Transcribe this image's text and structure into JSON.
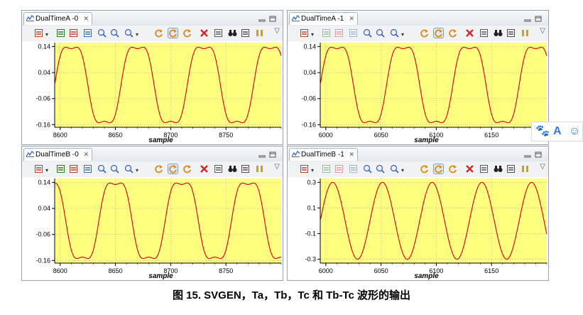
{
  "panels": [
    {
      "tab_title": "DualTimeA -0",
      "xlabel": "sample",
      "xlim": [
        8595,
        8800
      ],
      "ylim": [
        -0.17,
        0.155
      ],
      "yticks": [
        "0.14",
        "0.04",
        "-0.06",
        "-0.16"
      ],
      "xticks": [
        "8600",
        "8650",
        "8700",
        "8750"
      ],
      "wave": {
        "kind": "flat_top",
        "period": 60,
        "phase": 0,
        "amplitude": 0.145,
        "offset": -0.0075
      },
      "toolbar_dimmed": false
    },
    {
      "tab_title": "DualTimeA -1",
      "xlabel": "sample",
      "xlim": [
        5995,
        6200
      ],
      "ylim": [
        -0.17,
        0.155
      ],
      "yticks": [
        "0.14",
        "0.04",
        "-0.06",
        "-0.16"
      ],
      "xticks": [
        "6000",
        "6050",
        "6100",
        "6150"
      ],
      "wave": {
        "kind": "flat_top",
        "period": 60,
        "phase": 0,
        "amplitude": 0.145,
        "offset": -0.0075
      },
      "toolbar_dimmed": true
    },
    {
      "tab_title": "DualTimeB -0",
      "xlabel": "sample",
      "xlim": [
        8595,
        8800
      ],
      "ylim": [
        -0.17,
        0.155
      ],
      "yticks": [
        "0.14",
        "0.04",
        "-0.06",
        "-0.16"
      ],
      "xticks": [
        "8600",
        "8650",
        "8700",
        "8750"
      ],
      "wave": {
        "kind": "flat_top",
        "period": 60,
        "phase": 20,
        "amplitude": 0.145,
        "offset": -0.0075
      },
      "toolbar_dimmed": false
    },
    {
      "tab_title": "DualTimeB -1",
      "xlabel": "sample",
      "xlim": [
        5995,
        6200
      ],
      "ylim": [
        -0.33,
        0.33
      ],
      "yticks": [
        "0.3",
        "0.1",
        "-0.1",
        "-0.3"
      ],
      "xticks": [
        "6000",
        "6050",
        "6100",
        "6150"
      ],
      "wave": {
        "kind": "sine",
        "period": 45,
        "phase": 0,
        "amplitude": 0.3,
        "offset": 0
      },
      "toolbar_dimmed": true
    }
  ],
  "toolbar_icons": [
    "probe-icon",
    "sync-scroll-icon",
    "align-icon",
    "export-icon",
    "zoom-in-icon",
    "zoom-out-icon",
    "zoom-fit-icon",
    "refresh-icon",
    "continuous-refresh-icon",
    "auto-scale-icon",
    "remove-icon",
    "properties-icon",
    "binoculars-icon",
    "pin-icon",
    "pause-icon"
  ],
  "floating_toolbar": {
    "paw": "🐾",
    "letter": "A",
    "smile": "☺"
  },
  "caption": "图 15. SVGEN，Ta，Tb，Tc 和 Tb-Tc 波形的输出",
  "colors": {
    "plot_bg": "#ffff80",
    "trace": "#cc0000",
    "grid": "#a0a0a0"
  }
}
